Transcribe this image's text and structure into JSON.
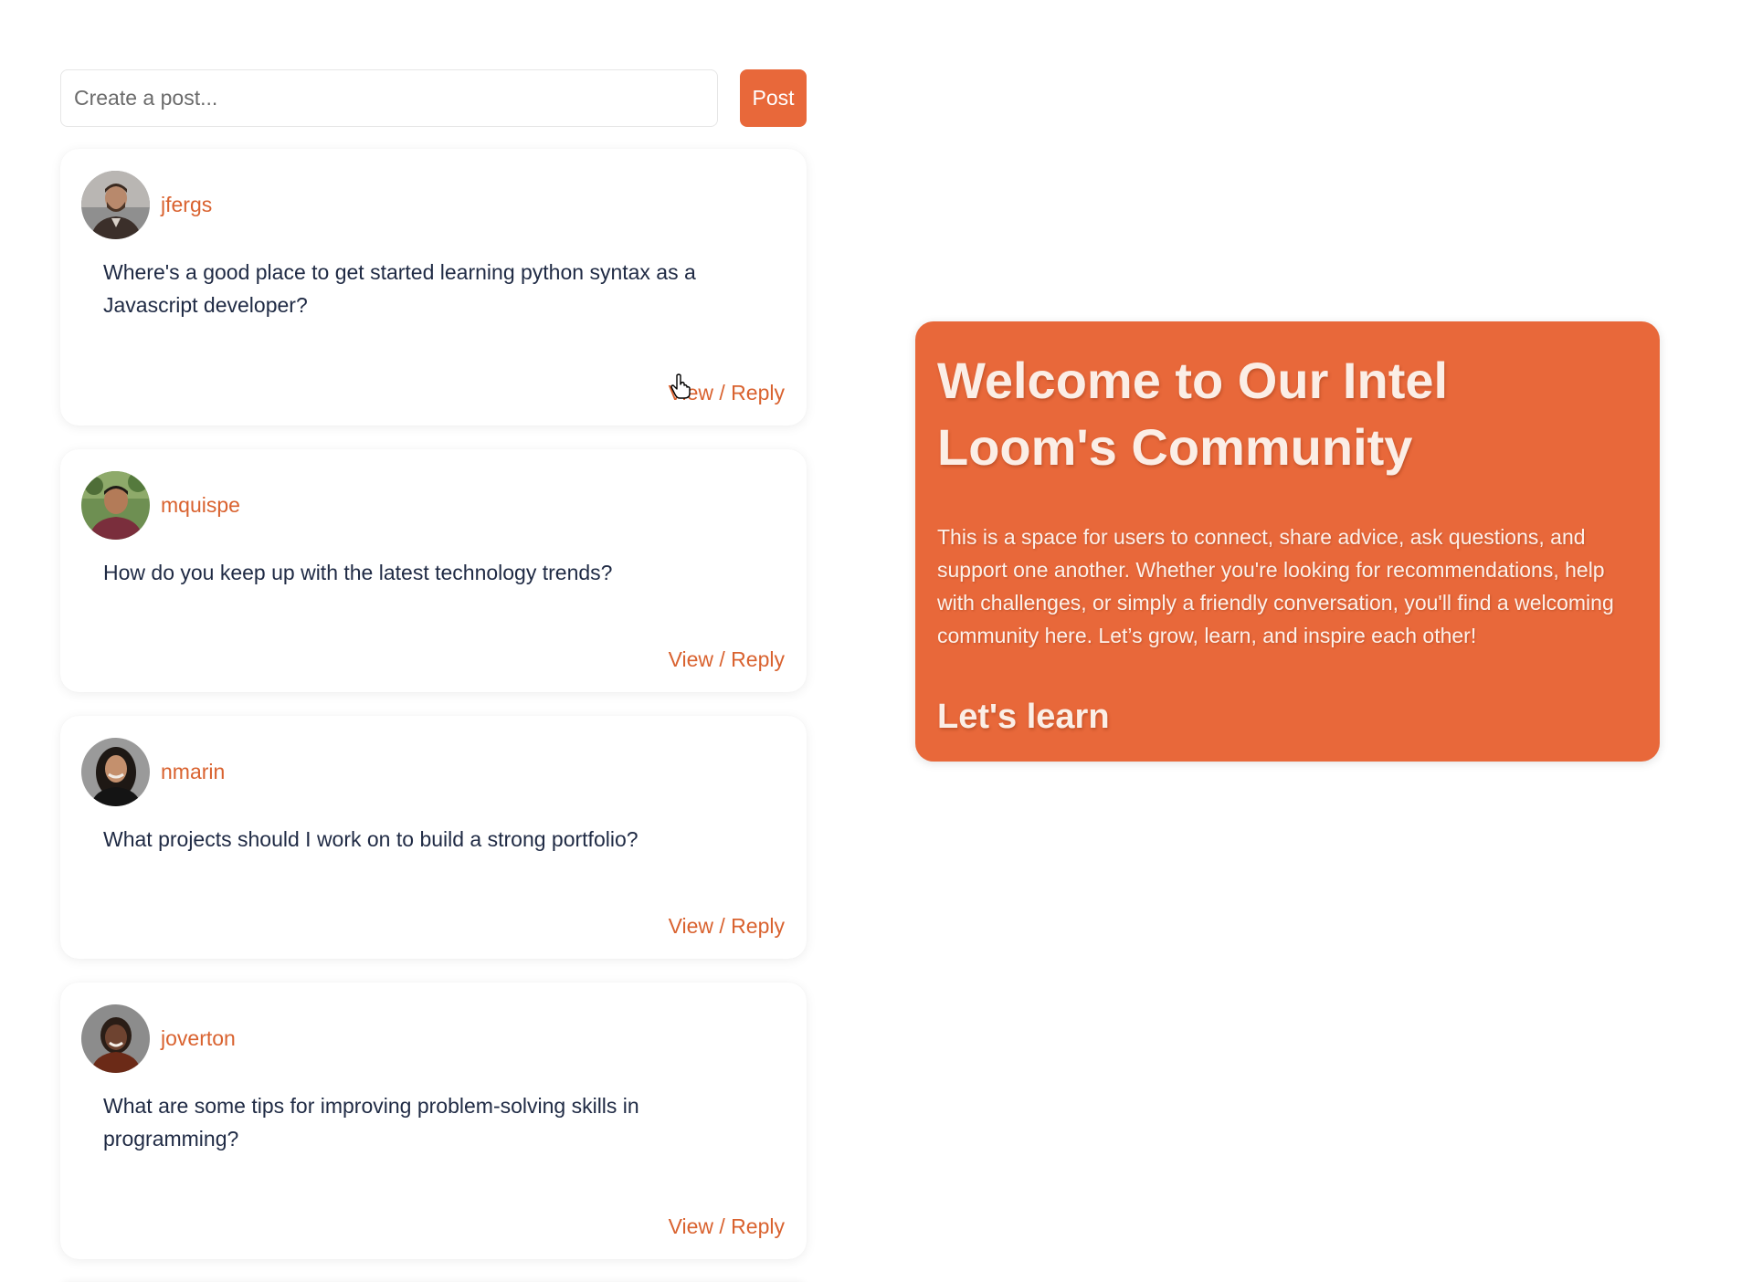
{
  "composer": {
    "placeholder": "Create a post...",
    "post_label": "Post"
  },
  "posts": [
    {
      "username": "jfergs",
      "text": "Where's a good place to get started learning python syntax as a Javascript developer?",
      "action_label": "View / Reply",
      "avatar": "man-beard-avatar"
    },
    {
      "username": "mquispe",
      "text": "How do you keep up with the latest technology trends?",
      "action_label": "View / Reply",
      "avatar": "man-outdoor-avatar"
    },
    {
      "username": "nmarin",
      "text": "What projects should I work on to build a strong portfolio?",
      "action_label": "View / Reply",
      "avatar": "woman-curly-hair-avatar"
    },
    {
      "username": "joverton",
      "text": "What are some tips for improving problem-solving skills in programming?",
      "action_label": "View / Reply",
      "avatar": "woman-smiling-avatar"
    }
  ],
  "welcome": {
    "title": "Welcome to Our Intel Loom's Community",
    "body": "This is a space for users to connect, share advice, ask questions, and support one another. Whether you're looking for recommendations, help with challenges, or simply a friendly conversation, you'll find a welcoming community here. Let’s grow, learn, and inspire each other!",
    "cta": "Let's learn"
  },
  "colors": {
    "accent": "#e8683a",
    "link": "#d9622f",
    "text": "#1f2a44"
  }
}
